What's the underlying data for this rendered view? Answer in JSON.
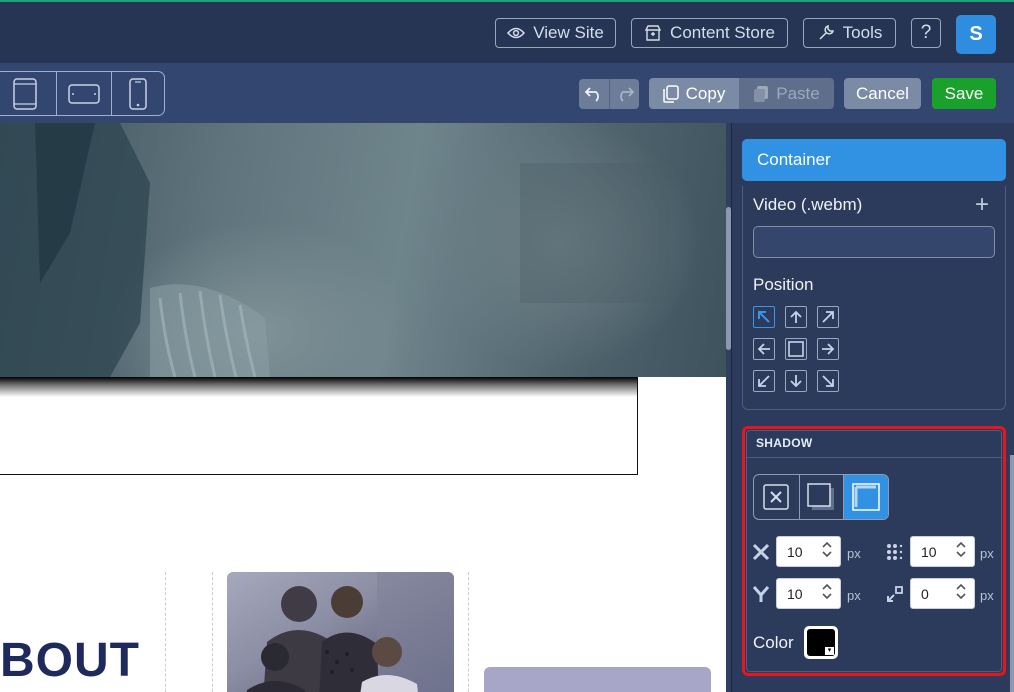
{
  "topbar": {
    "view_site": "View Site",
    "content_store": "Content Store",
    "tools": "Tools",
    "help": "?",
    "avatar_initial": "S"
  },
  "toolbar": {
    "devices": [
      "desktop-tablet-icon",
      "tablet-landscape-icon",
      "phone-icon"
    ],
    "copy": "Copy",
    "paste": "Paste",
    "cancel": "Cancel",
    "save": "Save"
  },
  "canvas": {
    "about_heading": "BOUT"
  },
  "panel": {
    "header": "Container",
    "video_label": "Video (.webm)",
    "video_add": "+",
    "video_value": "",
    "position_label": "Position",
    "position_selected": "top-left",
    "shadow": {
      "title": "SHADOW",
      "modes": [
        "none",
        "outer",
        "inner"
      ],
      "active_mode": "inner",
      "x": "10",
      "y": "10",
      "blur": "10",
      "spread": "0",
      "unit": "px",
      "color_label": "Color",
      "color": "#000000"
    }
  },
  "colors": {
    "accent": "#3192e4",
    "save": "#1aa12c",
    "highlight": "#e8161c"
  }
}
